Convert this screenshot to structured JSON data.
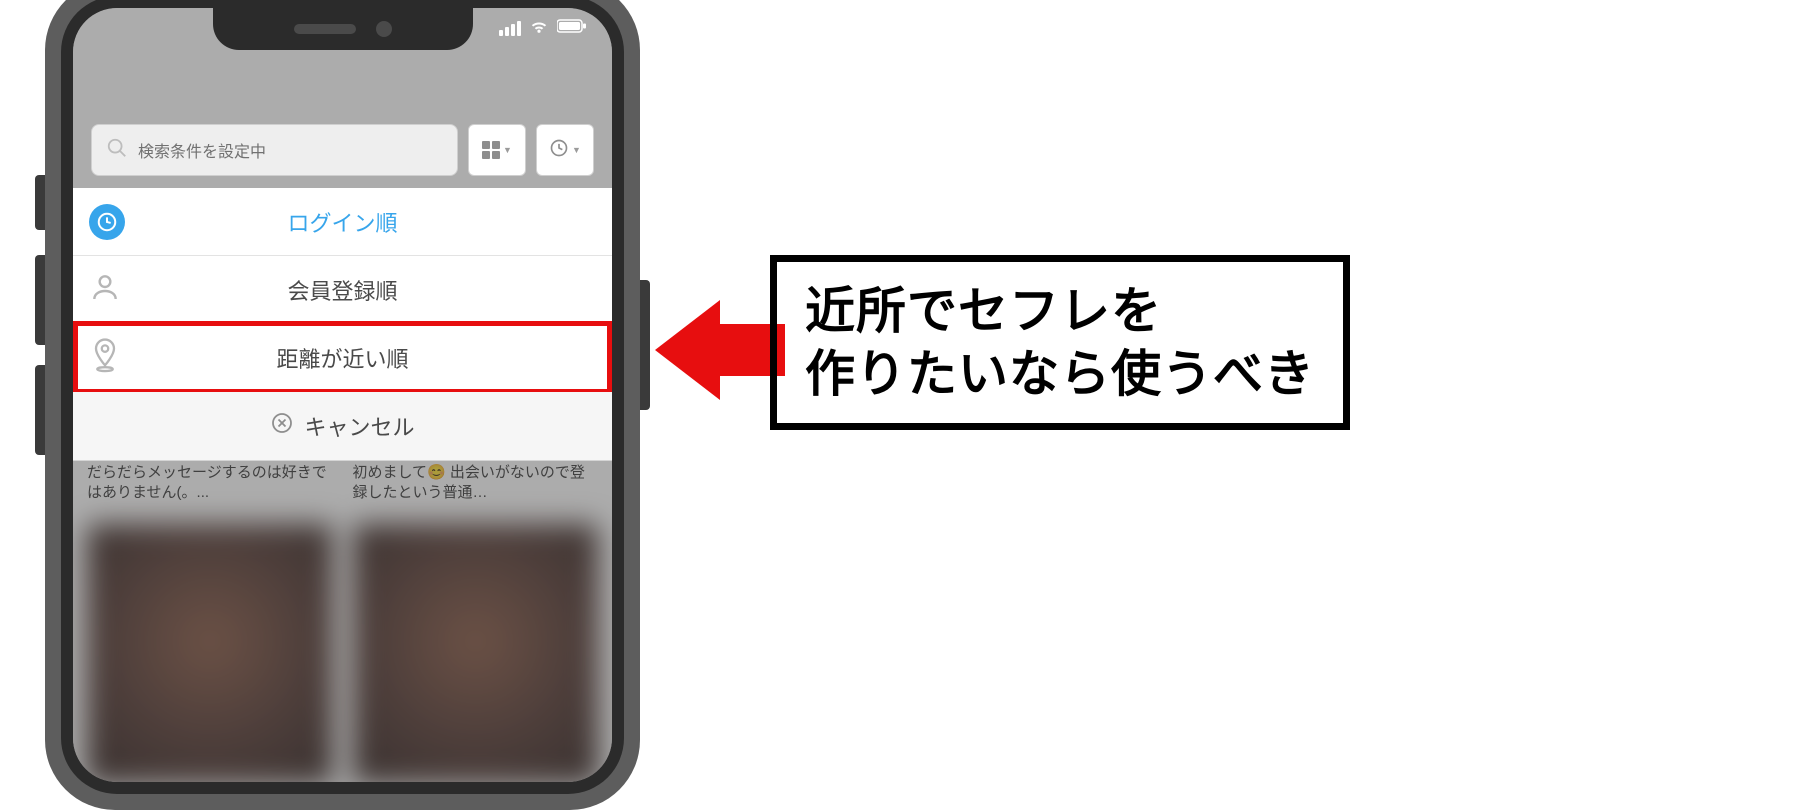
{
  "search": {
    "placeholder": "検索条件を設定中"
  },
  "sort_sheet": {
    "options": [
      {
        "label": "ログイン順",
        "icon": "clock-icon",
        "active": true
      },
      {
        "label": "会員登録順",
        "icon": "person-icon",
        "active": false
      },
      {
        "label": "距離が近い順",
        "icon": "location-pin-icon",
        "active": false,
        "highlighted": true
      }
    ],
    "cancel_label": "キャンセル"
  },
  "background_profiles": [
    {
      "snippet": "だらだらメッセージするのは好きではありません(。..."
    },
    {
      "snippet": "初めまして😊 出会いがないので登録したという普通…"
    }
  ],
  "callout": {
    "line1": "近所でセフレを",
    "line2": "作りたいなら使うべき"
  }
}
